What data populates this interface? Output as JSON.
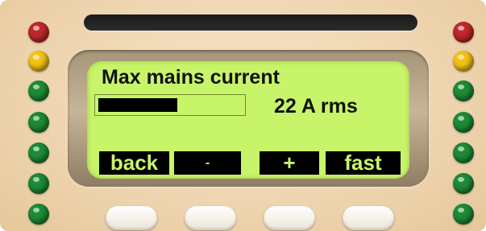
{
  "display": {
    "title": "Max mains current",
    "reading": "22 A rms",
    "bar_fill_fraction": 0.55
  },
  "softkeys": {
    "back": "back",
    "minus": "-",
    "plus": "+",
    "fast": "fast"
  },
  "leds": {
    "left": [
      "red",
      "yellow",
      "green",
      "green",
      "green",
      "green",
      "green"
    ],
    "right": [
      "red",
      "yellow",
      "green",
      "green",
      "green",
      "green",
      "green"
    ]
  },
  "colors": {
    "screen": "#c8f46a",
    "panel": "#efd6b1",
    "led_red": "#c0282b",
    "led_yellow": "#f2c216",
    "led_green": "#1d8b35"
  }
}
